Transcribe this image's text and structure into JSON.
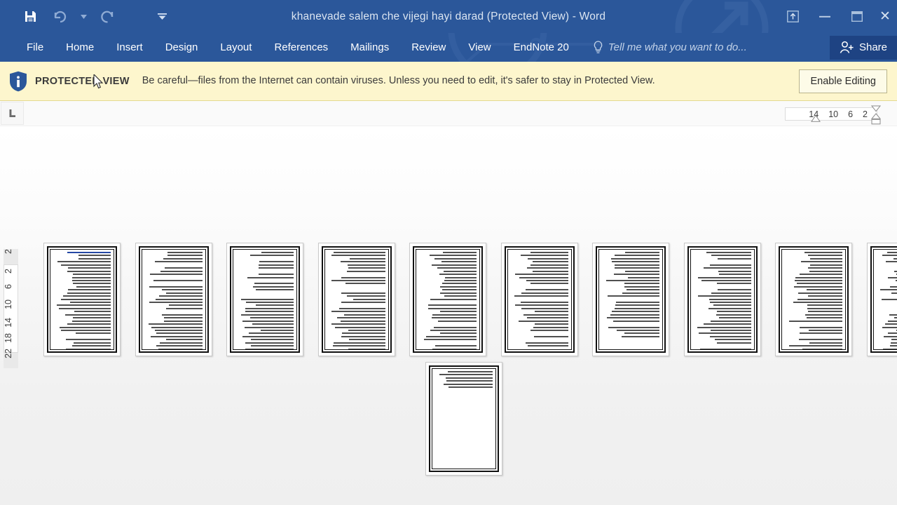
{
  "titlebar": {
    "document_title": "khanevade salem che vijegi hayi darad (Protected View) - Word",
    "quick_access": [
      {
        "name": "save",
        "icon": "save-icon",
        "enabled": true
      },
      {
        "name": "undo",
        "icon": "undo-icon",
        "enabled": false
      },
      {
        "name": "undo-dropdown",
        "icon": "chevron-down-icon",
        "enabled": false
      },
      {
        "name": "redo",
        "icon": "redo-icon",
        "enabled": false
      },
      {
        "name": "customize-quick-access-toolbar",
        "icon": "chevron-down-icon",
        "enabled": true
      }
    ],
    "window_controls": [
      {
        "name": "ribbon-display-options",
        "icon": "ribbon-display-icon",
        "glyph": ""
      },
      {
        "name": "minimize",
        "icon": "minimize-icon",
        "glyph": "–"
      },
      {
        "name": "restore",
        "icon": "restore-icon",
        "glyph": ""
      },
      {
        "name": "close",
        "icon": "close-icon",
        "glyph": "✕"
      }
    ]
  },
  "ribbon": {
    "tabs": [
      {
        "label": "File",
        "active": false
      },
      {
        "label": "Home",
        "active": false
      },
      {
        "label": "Insert",
        "active": false
      },
      {
        "label": "Design",
        "active": false
      },
      {
        "label": "Layout",
        "active": false
      },
      {
        "label": "References",
        "active": false
      },
      {
        "label": "Mailings",
        "active": false
      },
      {
        "label": "Review",
        "active": false
      },
      {
        "label": "View",
        "active": false
      },
      {
        "label": "EndNote 20",
        "active": false
      }
    ],
    "tell_me_placeholder": "Tell me what you want to do...",
    "share_label": "Share"
  },
  "protected_view": {
    "label": "PROTECTED VIEW",
    "message": "Be careful—files from the Internet can contain viruses. Unless you need to edit, it's safer to stay in Protected View.",
    "enable_button": "Enable Editing",
    "background_color": "#fdf6cd",
    "shield_color": "#2b579a"
  },
  "ruler": {
    "tab_stop_marker": "left-tab-stop",
    "horizontal_numbers": [
      "14",
      "10",
      "6",
      "2"
    ],
    "vertical_numbers_top": [
      "2"
    ],
    "vertical_numbers": [
      "2",
      "6",
      "10",
      "14",
      "18",
      "22"
    ]
  },
  "document": {
    "page_count": 11,
    "view_mode": "multiple-pages",
    "language_direction": "rtl",
    "pages": [
      {
        "number": 1,
        "has_heading": true,
        "lines": 34
      },
      {
        "number": 2,
        "has_heading": false,
        "lines": 34
      },
      {
        "number": 3,
        "has_heading": false,
        "lines": 34
      },
      {
        "number": 4,
        "has_heading": false,
        "lines": 34
      },
      {
        "number": 5,
        "has_heading": false,
        "lines": 34
      },
      {
        "number": 6,
        "has_heading": false,
        "lines": 34
      },
      {
        "number": 7,
        "has_heading": false,
        "lines": 30
      },
      {
        "number": 8,
        "has_heading": false,
        "lines": 34
      },
      {
        "number": 9,
        "has_heading": false,
        "lines": 34
      },
      {
        "number": 10,
        "has_heading": false,
        "lines": 34
      },
      {
        "number": 11,
        "has_heading": false,
        "lines": 6
      }
    ]
  },
  "colors": {
    "word_blue": "#2b579a",
    "share_blue": "#1e4383",
    "warning_yellow": "#fdf6cd",
    "canvas": "#f1f1f1"
  }
}
